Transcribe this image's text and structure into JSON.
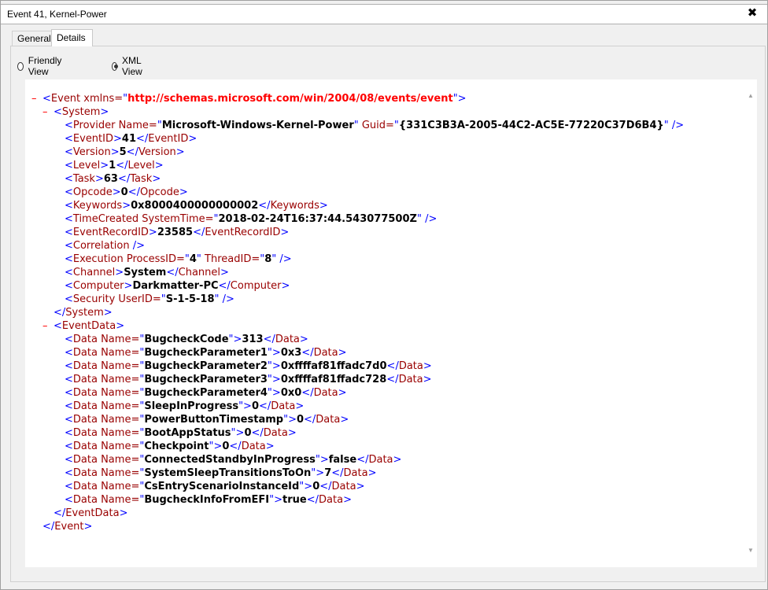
{
  "window": {
    "title": "Event 41, Kernel-Power",
    "close_glyph": "✖"
  },
  "tabs": [
    {
      "label": "General"
    },
    {
      "label": "Details"
    }
  ],
  "view_options": {
    "friendly": "Friendly View",
    "xml": "XML View",
    "selected": "xml"
  },
  "xml": {
    "ns_attr": "xmlns",
    "ns_value": "http://schemas.microsoft.com/win/2004/08/events/event",
    "provider_name": "Microsoft-Windows-Kernel-Power",
    "provider_guid": "{331C3B3A-2005-44C2-AC5E-77220C37D6B4}",
    "event_id": "41",
    "version": "5",
    "level": "1",
    "task": "63",
    "opcode": "0",
    "keywords": "0x8000400000000002",
    "system_time": "2018-02-24T16:37:44.543077500Z",
    "event_record_id": "23585",
    "process_id": "4",
    "thread_id": "8",
    "channel": "System",
    "computer": "Darkmatter-PC",
    "user_id": "S-1-5-18",
    "data": [
      {
        "name": "BugcheckCode",
        "value": "313"
      },
      {
        "name": "BugcheckParameter1",
        "value": "0x3"
      },
      {
        "name": "BugcheckParameter2",
        "value": "0xffffaf81ffadc7d0"
      },
      {
        "name": "BugcheckParameter3",
        "value": "0xffffaf81ffadc728"
      },
      {
        "name": "BugcheckParameter4",
        "value": "0x0"
      },
      {
        "name": "SleepInProgress",
        "value": "0"
      },
      {
        "name": "PowerButtonTimestamp",
        "value": "0"
      },
      {
        "name": "BootAppStatus",
        "value": "0"
      },
      {
        "name": "Checkpoint",
        "value": "0"
      },
      {
        "name": "ConnectedStandbyInProgress",
        "value": "false"
      },
      {
        "name": "SystemSleepTransitionsToOn",
        "value": "7"
      },
      {
        "name": "CsEntryScenarioInstanceId",
        "value": "0"
      },
      {
        "name": "BugcheckInfoFromEFI",
        "value": "true"
      }
    ]
  },
  "colors": {
    "tag": "#0000ff",
    "name": "#990000",
    "collapse": "#ff0000"
  }
}
